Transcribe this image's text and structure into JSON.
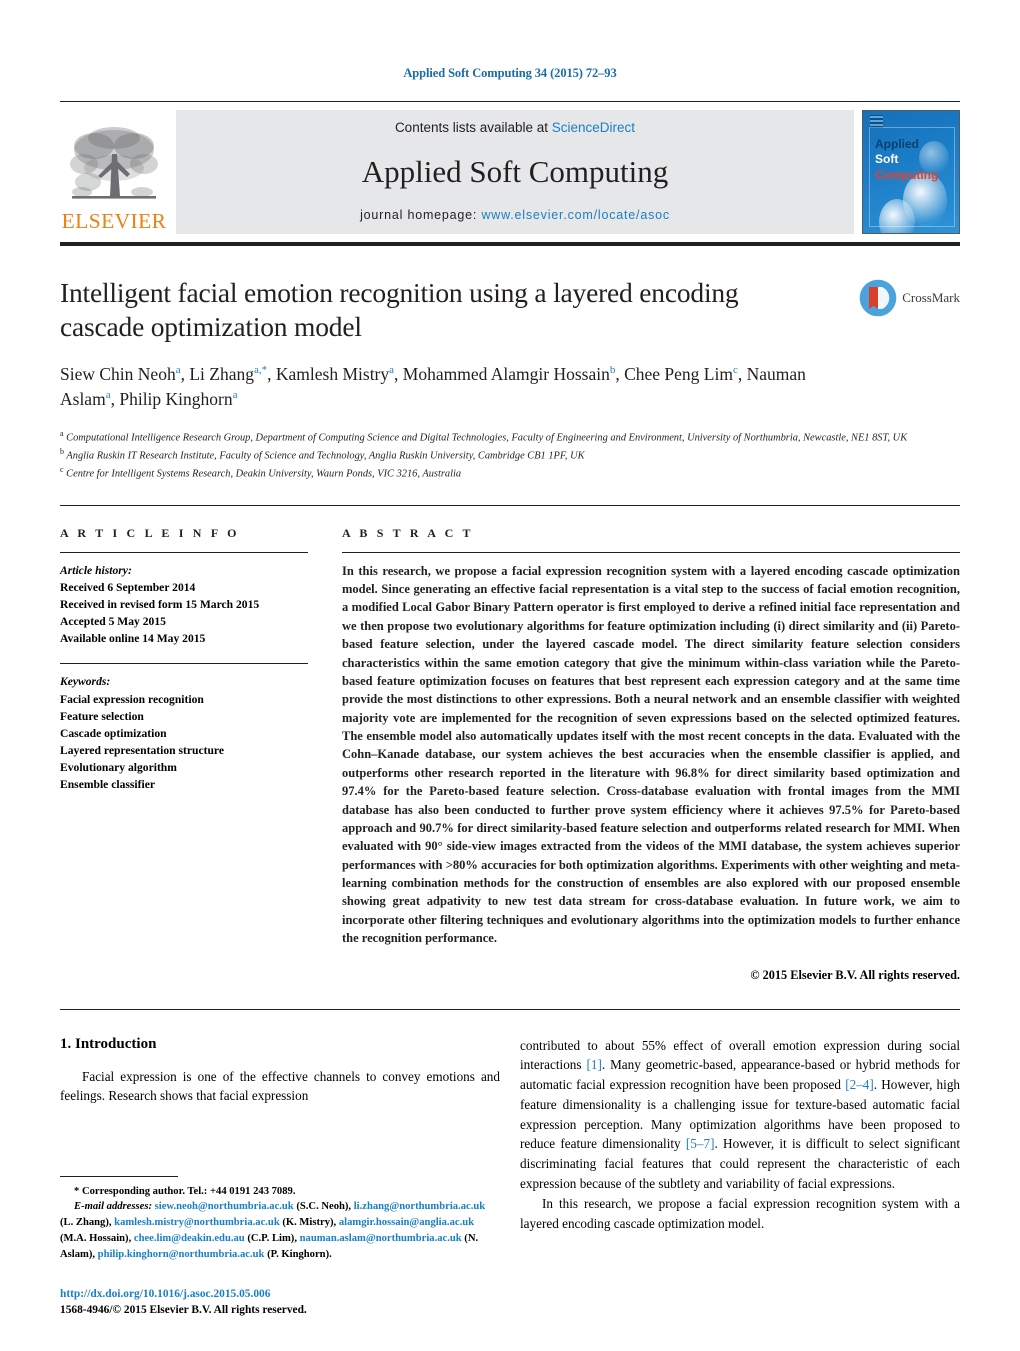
{
  "running_head": "Applied Soft Computing 34 (2015) 72–93",
  "masthead": {
    "contents_prefix": "Contents lists available at ",
    "sciencedirect": "ScienceDirect",
    "journal_title": "Applied Soft Computing",
    "homepage_prefix": "journal homepage: ",
    "homepage_url": "www.elsevier.com/locate/asoc",
    "publisher_name": "ELSEVIER",
    "cover": {
      "line1": "Applied",
      "line2": "Soft",
      "line3": "Computing"
    },
    "colors": {
      "link": "#1b7fc3",
      "elsevier_orange": "#ec8013",
      "cover_blue": "#1b7cc6",
      "band_gray": "#e6e7e8"
    }
  },
  "article": {
    "title": "Intelligent facial emotion recognition using a layered encoding cascade optimization model",
    "authors": [
      {
        "name": "Siew Chin Neoh",
        "marks": "a",
        "sep": ", "
      },
      {
        "name": "Li Zhang",
        "marks": "a,*",
        "sep": ", "
      },
      {
        "name": "Kamlesh Mistry",
        "marks": "a",
        "sep": ", "
      },
      {
        "name": "Mohammed Alamgir Hossain",
        "marks": "b",
        "sep": ", "
      },
      {
        "name": "Chee Peng Lim",
        "marks": "c",
        "sep": ", "
      },
      {
        "name": "Nauman Aslam",
        "marks": "a",
        "sep": ", "
      },
      {
        "name": "Philip Kinghorn",
        "marks": "a",
        "sep": ""
      }
    ],
    "affiliations": [
      {
        "mark": "a",
        "text": "Computational Intelligence Research Group, Department of Computing Science and Digital Technologies, Faculty of Engineering and Environment, University of Northumbria, Newcastle, NE1 8ST, UK"
      },
      {
        "mark": "b",
        "text": "Anglia Ruskin IT Research Institute, Faculty of Science and Technology, Anglia Ruskin University, Cambridge CB1 1PF, UK"
      },
      {
        "mark": "c",
        "text": "Centre for Intelligent Systems Research, Deakin University, Waurn Ponds, VIC 3216, Australia"
      }
    ],
    "crossmark_label": "CrossMark"
  },
  "article_info": {
    "heading": "A R T I C L E   I N F O",
    "history_label": "Article history:",
    "history": [
      "Received 6 September 2014",
      "Received in revised form 15 March 2015",
      "Accepted 5 May 2015",
      "Available online 14 May 2015"
    ],
    "keywords_label": "Keywords:",
    "keywords": [
      "Facial expression recognition",
      "Feature selection",
      "Cascade optimization",
      "Layered representation structure",
      "Evolutionary algorithm",
      "Ensemble classifier"
    ]
  },
  "abstract": {
    "heading": "A B S T R A C T",
    "text": "In this research, we propose a facial expression recognition system with a layered encoding cascade optimization model. Since generating an effective facial representation is a vital step to the success of facial emotion recognition, a modified Local Gabor Binary Pattern operator is first employed to derive a refined initial face representation and we then propose two evolutionary algorithms for feature optimization including (i) direct similarity and (ii) Pareto-based feature selection, under the layered cascade model. The direct similarity feature selection considers characteristics within the same emotion category that give the minimum within-class variation while the Pareto-based feature optimization focuses on features that best represent each expression category and at the same time provide the most distinctions to other expressions. Both a neural network and an ensemble classifier with weighted majority vote are implemented for the recognition of seven expressions based on the selected optimized features. The ensemble model also automatically updates itself with the most recent concepts in the data. Evaluated with the Cohn–Kanade database, our system achieves the best accuracies when the ensemble classifier is applied, and outperforms other research reported in the literature with 96.8% for direct similarity based optimization and 97.4% for the Pareto-based feature selection. Cross-database evaluation with frontal images from the MMI database has also been conducted to further prove system efficiency where it achieves 97.5% for Pareto-based approach and 90.7% for direct similarity-based feature selection and outperforms related research for MMI. When evaluated with 90° side-view images extracted from the videos of the MMI database, the system achieves superior performances with >80% accuracies for both optimization algorithms. Experiments with other weighting and meta-learning combination methods for the construction of ensembles are also explored with our proposed ensemble showing great adpativity to new test data stream for cross-database evaluation. In future work, we aim to incorporate other filtering techniques and evolutionary algorithms into the optimization models to further enhance the recognition performance.",
    "copyright": "© 2015 Elsevier B.V. All rights reserved."
  },
  "body": {
    "section_number_title": "1. Introduction",
    "left_para_1": "Facial expression is one of the effective channels to convey emotions and feelings. Research shows that facial expression",
    "right_para_1_a": "contributed to about 55% effect of overall emotion expression during social interactions ",
    "right_ref_1": "[1]",
    "right_para_1_b": ". Many geometric-based, appearance-based or hybrid methods for automatic facial expression recognition have been proposed ",
    "right_ref_2": "[2–4]",
    "right_para_1_c": ". However, high feature dimensionality is a challenging issue for texture-based automatic facial expression perception. Many optimization algorithms have been proposed to reduce feature dimensionality ",
    "right_ref_3": "[5–7]",
    "right_para_1_d": ". However, it is difficult to select significant discriminating facial features that could represent the characteristic of each expression because of the subtlety and variability of facial expressions.",
    "right_para_2": "In this research, we propose a facial expression recognition system with a layered encoding cascade optimization model."
  },
  "footnote": {
    "corresponding": "* Corresponding author. Tel.: +44 0191 243 7089.",
    "email_label": "E-mail addresses:",
    "emails": [
      {
        "address": "siew.neoh@northumbria.ac.uk",
        "owner": " (S.C. Neoh), "
      },
      {
        "address": "li.zhang@northumbria.ac.uk",
        "owner": " (L. Zhang), "
      },
      {
        "address": "kamlesh.mistry@northumbria.ac.uk",
        "owner": " (K. Mistry), "
      },
      {
        "address": "alamgir.hossain@anglia.ac.uk",
        "owner": " (M.A. Hossain), "
      },
      {
        "address": "chee.lim@deakin.edu.au",
        "owner": " (C.P. Lim), "
      },
      {
        "address": "nauman.aslam@northumbria.ac.uk",
        "owner": " (N. Aslam), "
      },
      {
        "address": "philip.kinghorn@northumbria.ac.uk",
        "owner": " (P. Kinghorn)."
      }
    ]
  },
  "doi_block": {
    "doi_url": "http://dx.doi.org/10.1016/j.asoc.2015.05.006",
    "issn_line": "1568-4946/© 2015 Elsevier B.V. All rights reserved."
  }
}
